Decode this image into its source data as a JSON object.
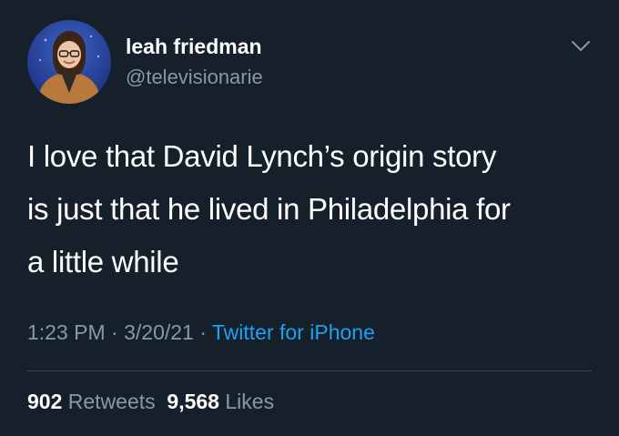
{
  "user": {
    "display_name": "leah friedman",
    "handle": "@televisionarie"
  },
  "tweet": {
    "text_lines": [
      "I love that David Lynch’s origin story",
      "is just that he lived in Philadelphia for",
      "a little while"
    ],
    "time": "1:23 PM",
    "separator": " · ",
    "date": "3/20/21",
    "source": "Twitter for iPhone"
  },
  "stats": {
    "retweets_count": "902",
    "retweets_label": "Retweets",
    "likes_count": "9,568",
    "likes_label": "Likes"
  },
  "icons": {
    "menu": "chevron-down-icon"
  },
  "colors": {
    "background": "#15202b",
    "secondary_text": "#8899a6",
    "link": "#1da1f2",
    "divider": "#38444d"
  }
}
